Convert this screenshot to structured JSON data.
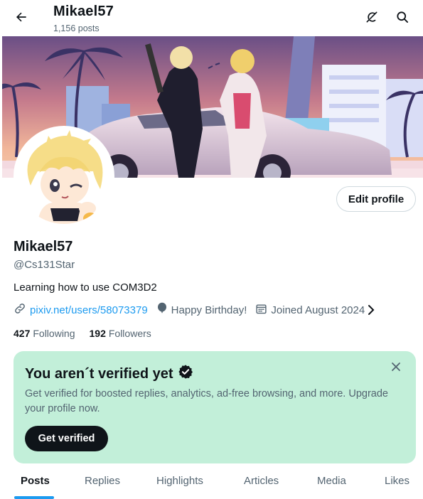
{
  "header": {
    "name": "Mikael57",
    "post_count": "1,156 posts",
    "icons": {
      "back": "arrow-left-icon",
      "grok": "grok-icon",
      "search": "search-icon"
    }
  },
  "profile": {
    "display_name": "Mikael57",
    "handle": "@Cs131Star",
    "bio": "Learning how to use COM3D2",
    "edit_label": "Edit profile",
    "website": "pixiv.net/users/58073379",
    "birthday": "Happy Birthday!",
    "joined": "Joined August 2024",
    "following_count": "427",
    "following_label": "Following",
    "followers_count": "192",
    "followers_label": "Followers"
  },
  "verify": {
    "title": "You aren´t verified yet",
    "description": "Get verified for boosted replies, analytics, ad-free browsing, and more. Upgrade your profile now.",
    "button": "Get verified"
  },
  "tabs": [
    {
      "label": "Posts",
      "active": true
    },
    {
      "label": "Replies",
      "active": false
    },
    {
      "label": "Highlights",
      "active": false
    },
    {
      "label": "Articles",
      "active": false
    },
    {
      "label": "Media",
      "active": false
    },
    {
      "label": "Likes",
      "active": false
    }
  ],
  "colors": {
    "accent": "#1d9bf0",
    "text": "#0f1419",
    "secondary": "#536471",
    "verify_card": "#c2efd9",
    "verified_badge": "#0f1419"
  }
}
